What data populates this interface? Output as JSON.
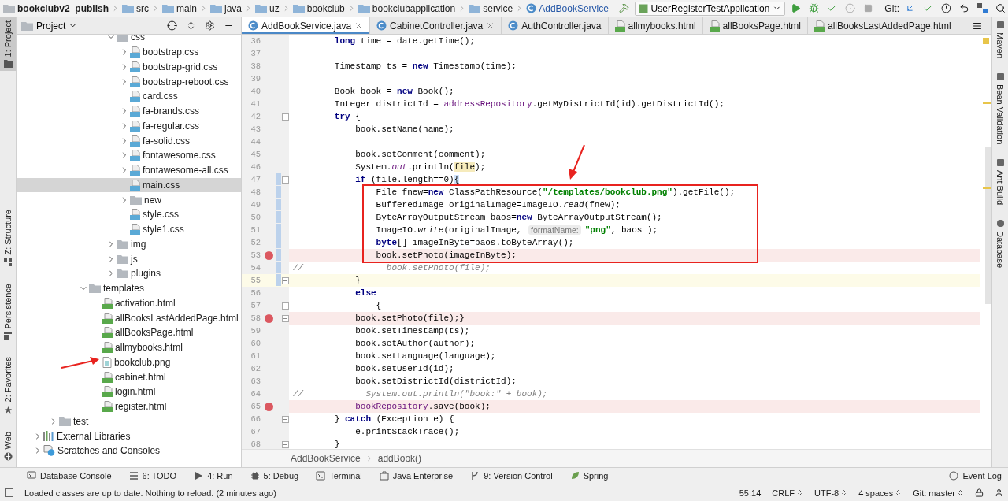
{
  "navigation_bar": {
    "path": [
      {
        "label": "bookclubv2_publish",
        "kind": "project"
      },
      {
        "label": "src",
        "kind": "folder"
      },
      {
        "label": "main",
        "kind": "folder"
      },
      {
        "label": "java",
        "kind": "folder"
      },
      {
        "label": "uz",
        "kind": "folder"
      },
      {
        "label": "bookclub",
        "kind": "folder"
      },
      {
        "label": "bookclubapplication",
        "kind": "folder"
      },
      {
        "label": "service",
        "kind": "folder"
      },
      {
        "label": "AddBookService",
        "kind": "class"
      }
    ],
    "run_configuration": "UserRegisterTestApplication",
    "vcs_label": "Git:"
  },
  "left_tool_windows": [
    {
      "label": "1: Project",
      "selected": true
    },
    {
      "label": "Z: Structure",
      "selected": false
    },
    {
      "label": "Persistence",
      "selected": false
    },
    {
      "label": "2: Favorites",
      "selected": false
    },
    {
      "label": "Web",
      "selected": false
    }
  ],
  "project_panel": {
    "title": "Project",
    "tree": [
      {
        "items": [
          {
            "label": "css",
            "kind": "folder",
            "expanded": true,
            "selected": false,
            "children": [
              {
                "label": "bootstrap.css",
                "kind": "css",
                "expanded": false,
                "selected": false
              },
              {
                "label": "bootstrap-grid.css",
                "kind": "css",
                "expanded": false,
                "selected": false
              },
              {
                "label": "bootstrap-reboot.css",
                "kind": "css",
                "expanded": false,
                "selected": false
              },
              {
                "label": "card.css",
                "kind": "css",
                "selected": false
              },
              {
                "label": "fa-brands.css",
                "kind": "css",
                "expanded": false,
                "selected": false
              },
              {
                "label": "fa-regular.css",
                "kind": "css",
                "expanded": false,
                "selected": false
              },
              {
                "label": "fa-solid.css",
                "kind": "css",
                "expanded": false,
                "selected": false
              },
              {
                "label": "fontawesome.css",
                "kind": "css",
                "expanded": false,
                "selected": false
              },
              {
                "label": "fontawesome-all.css",
                "kind": "css",
                "expanded": false,
                "selected": false
              },
              {
                "label": "main.css",
                "kind": "css",
                "selected": true
              },
              {
                "label": "new",
                "kind": "folder",
                "expanded": false,
                "selected": false
              },
              {
                "label": "style.css",
                "kind": "css",
                "selected": false
              },
              {
                "label": "style1.css",
                "kind": "css",
                "selected": false
              }
            ]
          },
          {
            "label": "img",
            "kind": "folder",
            "expanded": false,
            "selected": false
          },
          {
            "label": "js",
            "kind": "folder",
            "expanded": false,
            "selected": false
          },
          {
            "label": "plugins",
            "kind": "folder",
            "expanded": false,
            "selected": false
          }
        ]
      },
      {
        "items": [
          {
            "label": "templates",
            "kind": "folder",
            "expanded": true,
            "selected": false,
            "children": [
              {
                "label": "activation.html",
                "kind": "html",
                "selected": false
              },
              {
                "label": "allBooksLastAddedPage.html",
                "kind": "html",
                "selected": false
              },
              {
                "label": "allBooksPage.html",
                "kind": "html",
                "selected": false
              },
              {
                "label": "allmybooks.html",
                "kind": "html",
                "selected": false
              },
              {
                "label": "bookclub.png",
                "kind": "image",
                "selected": false
              },
              {
                "label": "cabinet.html",
                "kind": "html",
                "selected": false
              },
              {
                "label": "login.html",
                "kind": "html",
                "selected": false
              },
              {
                "label": "register.html",
                "kind": "html",
                "selected": false
              }
            ]
          }
        ]
      },
      {
        "items": [
          {
            "label": "test",
            "kind": "folder",
            "expanded": false,
            "selected": false
          }
        ]
      },
      {
        "items": [
          {
            "label": "External Libraries",
            "kind": "library",
            "expanded": false,
            "selected": false
          },
          {
            "label": "Scratches and Consoles",
            "kind": "scratches",
            "expanded": false,
            "selected": false
          }
        ]
      }
    ]
  },
  "editor_tabs": [
    {
      "label": "AddBookService.java",
      "kind": "class",
      "selected": true,
      "closable": true
    },
    {
      "label": "CabinetController.java",
      "kind": "class",
      "selected": false,
      "closable": true
    },
    {
      "label": "AuthController.java",
      "kind": "class",
      "selected": false,
      "closable": false
    },
    {
      "label": "allmybooks.html",
      "kind": "html",
      "selected": false,
      "closable": false
    },
    {
      "label": "allBooksPage.html",
      "kind": "html",
      "selected": false,
      "closable": false
    },
    {
      "label": "allBooksLastAddedPage.html",
      "kind": "html",
      "selected": false,
      "closable": false
    }
  ],
  "code_lines": [
    {
      "number": "36",
      "breakpoint": false,
      "changed": false,
      "fold": false,
      "current": false,
      "tokens": [
        {
          "text": "        long",
          "kind": "keyword"
        },
        {
          "text": " time = date.getTime();",
          "kind": "plain"
        }
      ]
    },
    {
      "number": "37",
      "breakpoint": false,
      "changed": false,
      "fold": false,
      "current": false
    },
    {
      "number": "38",
      "breakpoint": false,
      "changed": false,
      "fold": false,
      "current": false,
      "tokens": [
        {
          "text": "        Timestamp ts = ",
          "kind": "plain"
        },
        {
          "text": "new",
          "kind": "keyword"
        },
        {
          "text": " Timestamp(time);",
          "kind": "plain"
        }
      ]
    },
    {
      "number": "39",
      "breakpoint": false,
      "changed": false,
      "fold": false,
      "current": false
    },
    {
      "number": "40",
      "breakpoint": false,
      "changed": false,
      "fold": false,
      "current": false,
      "tokens": [
        {
          "text": "        Book book = ",
          "kind": "plain"
        },
        {
          "text": "new",
          "kind": "keyword"
        },
        {
          "text": " Book();",
          "kind": "plain"
        }
      ]
    },
    {
      "number": "41",
      "breakpoint": false,
      "changed": false,
      "fold": false,
      "current": false,
      "tokens": [
        {
          "text": "        Integer districtId = ",
          "kind": "plain"
        },
        {
          "text": "addressRepository",
          "kind": "field"
        },
        {
          "text": ".getMyDistrictId(id).getDistrictId();",
          "kind": "plain"
        }
      ]
    },
    {
      "number": "42",
      "breakpoint": false,
      "changed": false,
      "fold": true,
      "current": false,
      "tokens": [
        {
          "text": "        try",
          "kind": "keyword"
        },
        {
          "text": " {",
          "kind": "plain"
        }
      ]
    },
    {
      "number": "43",
      "breakpoint": false,
      "changed": false,
      "fold": false,
      "current": false,
      "tokens": [
        {
          "text": "            book.setName(name);",
          "kind": "plain"
        }
      ]
    },
    {
      "number": "44",
      "breakpoint": false,
      "changed": false,
      "fold": false,
      "current": false
    },
    {
      "number": "45",
      "breakpoint": false,
      "changed": false,
      "fold": false,
      "current": false,
      "tokens": [
        {
          "text": "            book.setComment(comment);",
          "kind": "plain"
        }
      ]
    },
    {
      "number": "46",
      "breakpoint": false,
      "changed": false,
      "fold": false,
      "current": false,
      "tokens": [
        {
          "text": "            System.",
          "kind": "plain"
        },
        {
          "text": "out",
          "kind": "static_field"
        },
        {
          "text": ".println(",
          "kind": "plain"
        },
        {
          "text": "file",
          "kind": "usage"
        },
        {
          "text": ");",
          "kind": "plain"
        }
      ]
    },
    {
      "number": "47",
      "breakpoint": false,
      "changed": true,
      "fold": true,
      "current": false,
      "tokens": [
        {
          "text": "            if",
          "kind": "keyword"
        },
        {
          "text": " (file.length==0)",
          "kind": "plain"
        },
        {
          "text": "{",
          "kind": "brace"
        }
      ]
    },
    {
      "number": "48",
      "breakpoint": false,
      "changed": true,
      "fold": false,
      "current": false,
      "tokens": [
        {
          "text": "                File fnew=",
          "kind": "plain"
        },
        {
          "text": "new",
          "kind": "keyword"
        },
        {
          "text": " ClassPathResource(",
          "kind": "plain"
        },
        {
          "text": "\"/templates/bookclub.png\"",
          "kind": "string"
        },
        {
          "text": ").getFile();",
          "kind": "plain"
        }
      ]
    },
    {
      "number": "49",
      "breakpoint": false,
      "changed": true,
      "fold": false,
      "current": false,
      "tokens": [
        {
          "text": "                BufferedImage originalImage=ImageIO.",
          "kind": "plain"
        },
        {
          "text": "read",
          "kind": "static"
        },
        {
          "text": "(fnew);",
          "kind": "plain"
        }
      ]
    },
    {
      "number": "50",
      "breakpoint": false,
      "changed": true,
      "fold": false,
      "current": false,
      "tokens": [
        {
          "text": "                ByteArrayOutputStream baos=",
          "kind": "plain"
        },
        {
          "text": "new",
          "kind": "keyword"
        },
        {
          "text": " ByteArrayOutputStream();",
          "kind": "plain"
        }
      ]
    },
    {
      "number": "51",
      "breakpoint": false,
      "changed": true,
      "fold": false,
      "current": false,
      "tokens": [
        {
          "text": "                ImageIO.",
          "kind": "plain"
        },
        {
          "text": "write",
          "kind": "static"
        },
        {
          "text": "(originalImage, ",
          "kind": "plain"
        },
        {
          "text": "formatName:",
          "kind": "hint"
        },
        {
          "text": "\"png\"",
          "kind": "string"
        },
        {
          "text": ", baos );",
          "kind": "plain"
        }
      ]
    },
    {
      "number": "52",
      "breakpoint": false,
      "changed": true,
      "fold": false,
      "current": false,
      "tokens": [
        {
          "text": "                byte",
          "kind": "keyword"
        },
        {
          "text": "[] imageInByte=baos.toByteArray();",
          "kind": "plain"
        }
      ]
    },
    {
      "number": "53",
      "breakpoint": true,
      "changed": true,
      "fold": false,
      "current": false,
      "tokens": [
        {
          "text": "                book.setPhoto(imageInByte);",
          "kind": "plain"
        }
      ]
    },
    {
      "number": "54",
      "breakpoint": false,
      "changed": true,
      "fold": false,
      "current": false,
      "tokens": [
        {
          "text": "//                book.setPhoto(file);",
          "kind": "comment"
        }
      ]
    },
    {
      "number": "55",
      "breakpoint": false,
      "changed": true,
      "fold": true,
      "current": true,
      "tokens": [
        {
          "text": "            }",
          "kind": "plain"
        }
      ]
    },
    {
      "number": "56",
      "breakpoint": false,
      "changed": false,
      "fold": false,
      "current": false,
      "tokens": [
        {
          "text": "            else",
          "kind": "keyword"
        }
      ]
    },
    {
      "number": "57",
      "breakpoint": false,
      "changed": false,
      "fold": true,
      "current": false,
      "tokens": [
        {
          "text": "                {",
          "kind": "plain"
        }
      ]
    },
    {
      "number": "58",
      "breakpoint": true,
      "changed": false,
      "fold": true,
      "current": false,
      "tokens": [
        {
          "text": "            book.setPhoto(file);}",
          "kind": "plain"
        }
      ]
    },
    {
      "number": "59",
      "breakpoint": false,
      "changed": false,
      "fold": false,
      "current": false,
      "tokens": [
        {
          "text": "            book.setTimestamp(ts);",
          "kind": "plain"
        }
      ]
    },
    {
      "number": "60",
      "breakpoint": false,
      "changed": false,
      "fold": false,
      "current": false,
      "tokens": [
        {
          "text": "            book.setAuthor(author);",
          "kind": "plain"
        }
      ]
    },
    {
      "number": "61",
      "breakpoint": false,
      "changed": false,
      "fold": false,
      "current": false,
      "tokens": [
        {
          "text": "            book.setLanguage(language);",
          "kind": "plain"
        }
      ]
    },
    {
      "number": "62",
      "breakpoint": false,
      "changed": false,
      "fold": false,
      "current": false,
      "tokens": [
        {
          "text": "            book.setUserId(id);",
          "kind": "plain"
        }
      ]
    },
    {
      "number": "63",
      "breakpoint": false,
      "changed": false,
      "fold": false,
      "current": false,
      "tokens": [
        {
          "text": "            book.setDistrictId(districtId);",
          "kind": "plain"
        }
      ]
    },
    {
      "number": "64",
      "breakpoint": false,
      "changed": false,
      "fold": false,
      "current": false,
      "tokens": [
        {
          "text": "//            System.out.println(\"book:\" + book);",
          "kind": "comment"
        }
      ]
    },
    {
      "number": "65",
      "breakpoint": true,
      "changed": false,
      "fold": false,
      "current": false,
      "tokens": [
        {
          "text": "            bookRepository",
          "kind": "field"
        },
        {
          "text": ".save(book);",
          "kind": "plain"
        }
      ]
    },
    {
      "number": "66",
      "breakpoint": false,
      "changed": false,
      "fold": true,
      "current": false,
      "tokens": [
        {
          "text": "        } ",
          "kind": "plain"
        },
        {
          "text": "catch",
          "kind": "keyword"
        },
        {
          "text": " (Exception e) {",
          "kind": "plain"
        }
      ]
    },
    {
      "number": "67",
      "breakpoint": false,
      "changed": false,
      "fold": false,
      "current": false,
      "tokens": [
        {
          "text": "            e.printStackTrace();",
          "kind": "plain"
        }
      ]
    },
    {
      "number": "68",
      "breakpoint": false,
      "changed": false,
      "fold": true,
      "current": false,
      "tokens": [
        {
          "text": "        }",
          "kind": "plain"
        }
      ]
    }
  ],
  "editor_breadcrumb": [
    "AddBookService",
    "addBook()"
  ],
  "right_tool_windows": [
    {
      "label": "Maven"
    },
    {
      "label": "Bean Validation"
    },
    {
      "label": "Ant Build"
    },
    {
      "label": "Database"
    }
  ],
  "bottom_tool_windows": [
    {
      "label": "Database Console"
    },
    {
      "label": "6: TODO"
    },
    {
      "label": "4: Run"
    },
    {
      "label": "5: Debug"
    },
    {
      "label": "Terminal"
    },
    {
      "label": "Java Enterprise"
    },
    {
      "label": "9: Version Control"
    },
    {
      "label": "Spring"
    }
  ],
  "event_log": "Event Log",
  "status_bar": {
    "message": "Loaded classes are up to date. Nothing to reload. (2 minutes ago)",
    "position": "55:14",
    "line_separator": "CRLF",
    "encoding": "UTF-8",
    "indent": "4 spaces",
    "branch": "Git: master"
  }
}
